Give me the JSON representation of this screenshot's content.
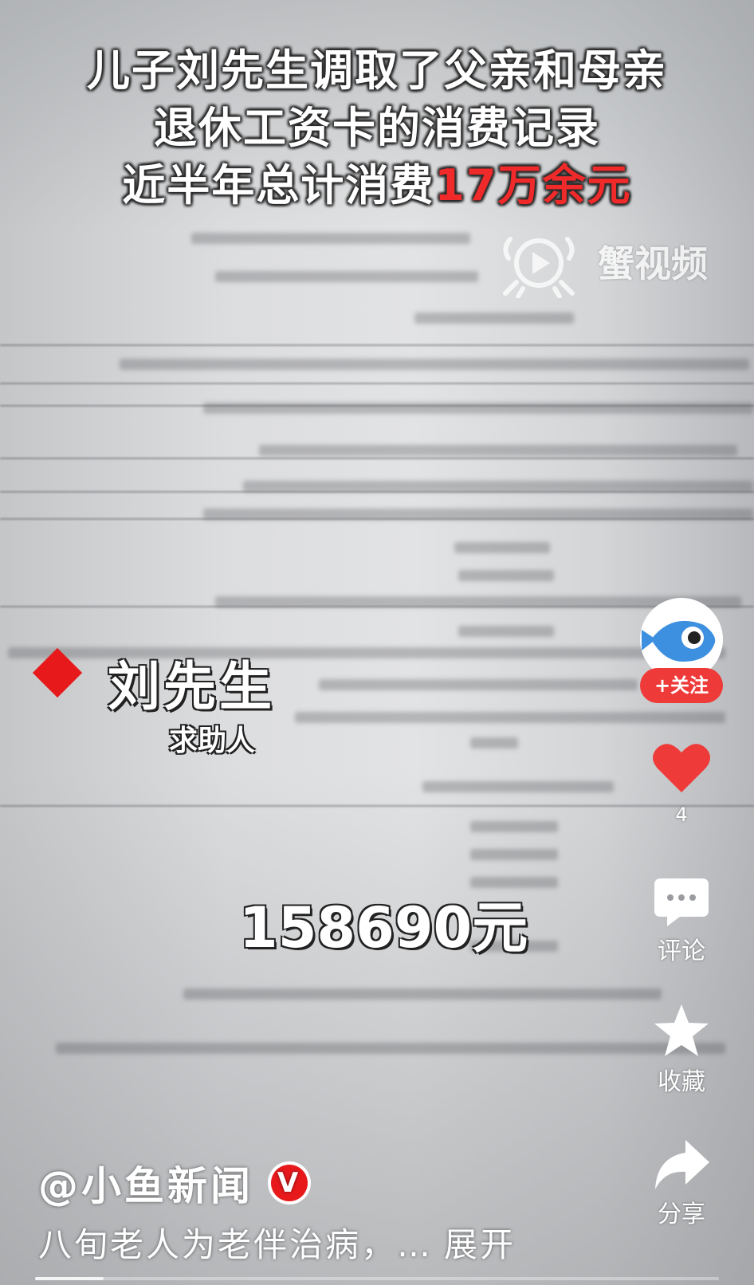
{
  "headline": {
    "line1": "儿子刘先生调取了父亲和母亲",
    "line2": "退休工资卡的消费记录",
    "line3_prefix": "近半年总计消费",
    "line3_highlight": "17万余元",
    "highlight_color": "#f02a2a"
  },
  "watermark": {
    "icon": "crab-play-icon",
    "label": "蟹视频"
  },
  "person": {
    "name": "刘先生",
    "role": "求助人",
    "marker_color": "#e8191b"
  },
  "amount": "158690元",
  "rail": {
    "follow_label": "+关注",
    "like_count": "4",
    "comment_label": "评论",
    "favorite_label": "收藏",
    "share_label": "分享",
    "accent": "#ef3a3a"
  },
  "post": {
    "author": "@小鱼新闻",
    "verified_badge": "V",
    "description": "八旬老人为老伴治病，…",
    "expand_label": "展开"
  },
  "progress": 0.1
}
